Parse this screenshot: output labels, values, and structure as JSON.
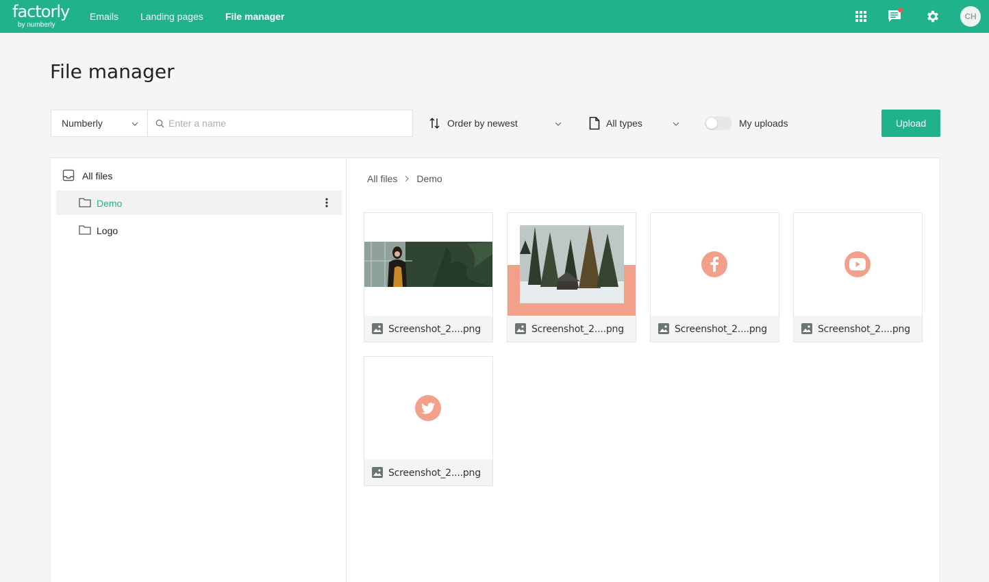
{
  "app": {
    "brand_name": "factorly",
    "brand_sub": "by numberly",
    "avatar_initials": "CH"
  },
  "nav": {
    "items": [
      {
        "label": "Emails"
      },
      {
        "label": "Landing pages"
      },
      {
        "label": "File manager",
        "active": true
      }
    ]
  },
  "colors": {
    "accent": "#20b38b",
    "thumb_accent": "#f3a08b"
  },
  "page": {
    "title": "File manager"
  },
  "toolbar": {
    "company": "Numberly",
    "search_placeholder": "Enter a name",
    "order": "Order by newest",
    "types": "All types",
    "my_uploads_label": "My uploads",
    "my_uploads_on": false,
    "upload_label": "Upload"
  },
  "tree": {
    "root": "All files",
    "folders": [
      {
        "label": "Demo",
        "active": true
      },
      {
        "label": "Logo",
        "active": false
      }
    ]
  },
  "breadcrumb": [
    "All files",
    "Demo"
  ],
  "files": [
    {
      "name": "Screenshot_2....png",
      "thumb": "photo-woman"
    },
    {
      "name": "Screenshot_2....png",
      "thumb": "photo-forest"
    },
    {
      "name": "Screenshot_2....png",
      "thumb": "facebook-icon"
    },
    {
      "name": "Screenshot_2....png",
      "thumb": "youtube-icon"
    },
    {
      "name": "Screenshot_2....png",
      "thumb": "twitter-icon"
    }
  ]
}
